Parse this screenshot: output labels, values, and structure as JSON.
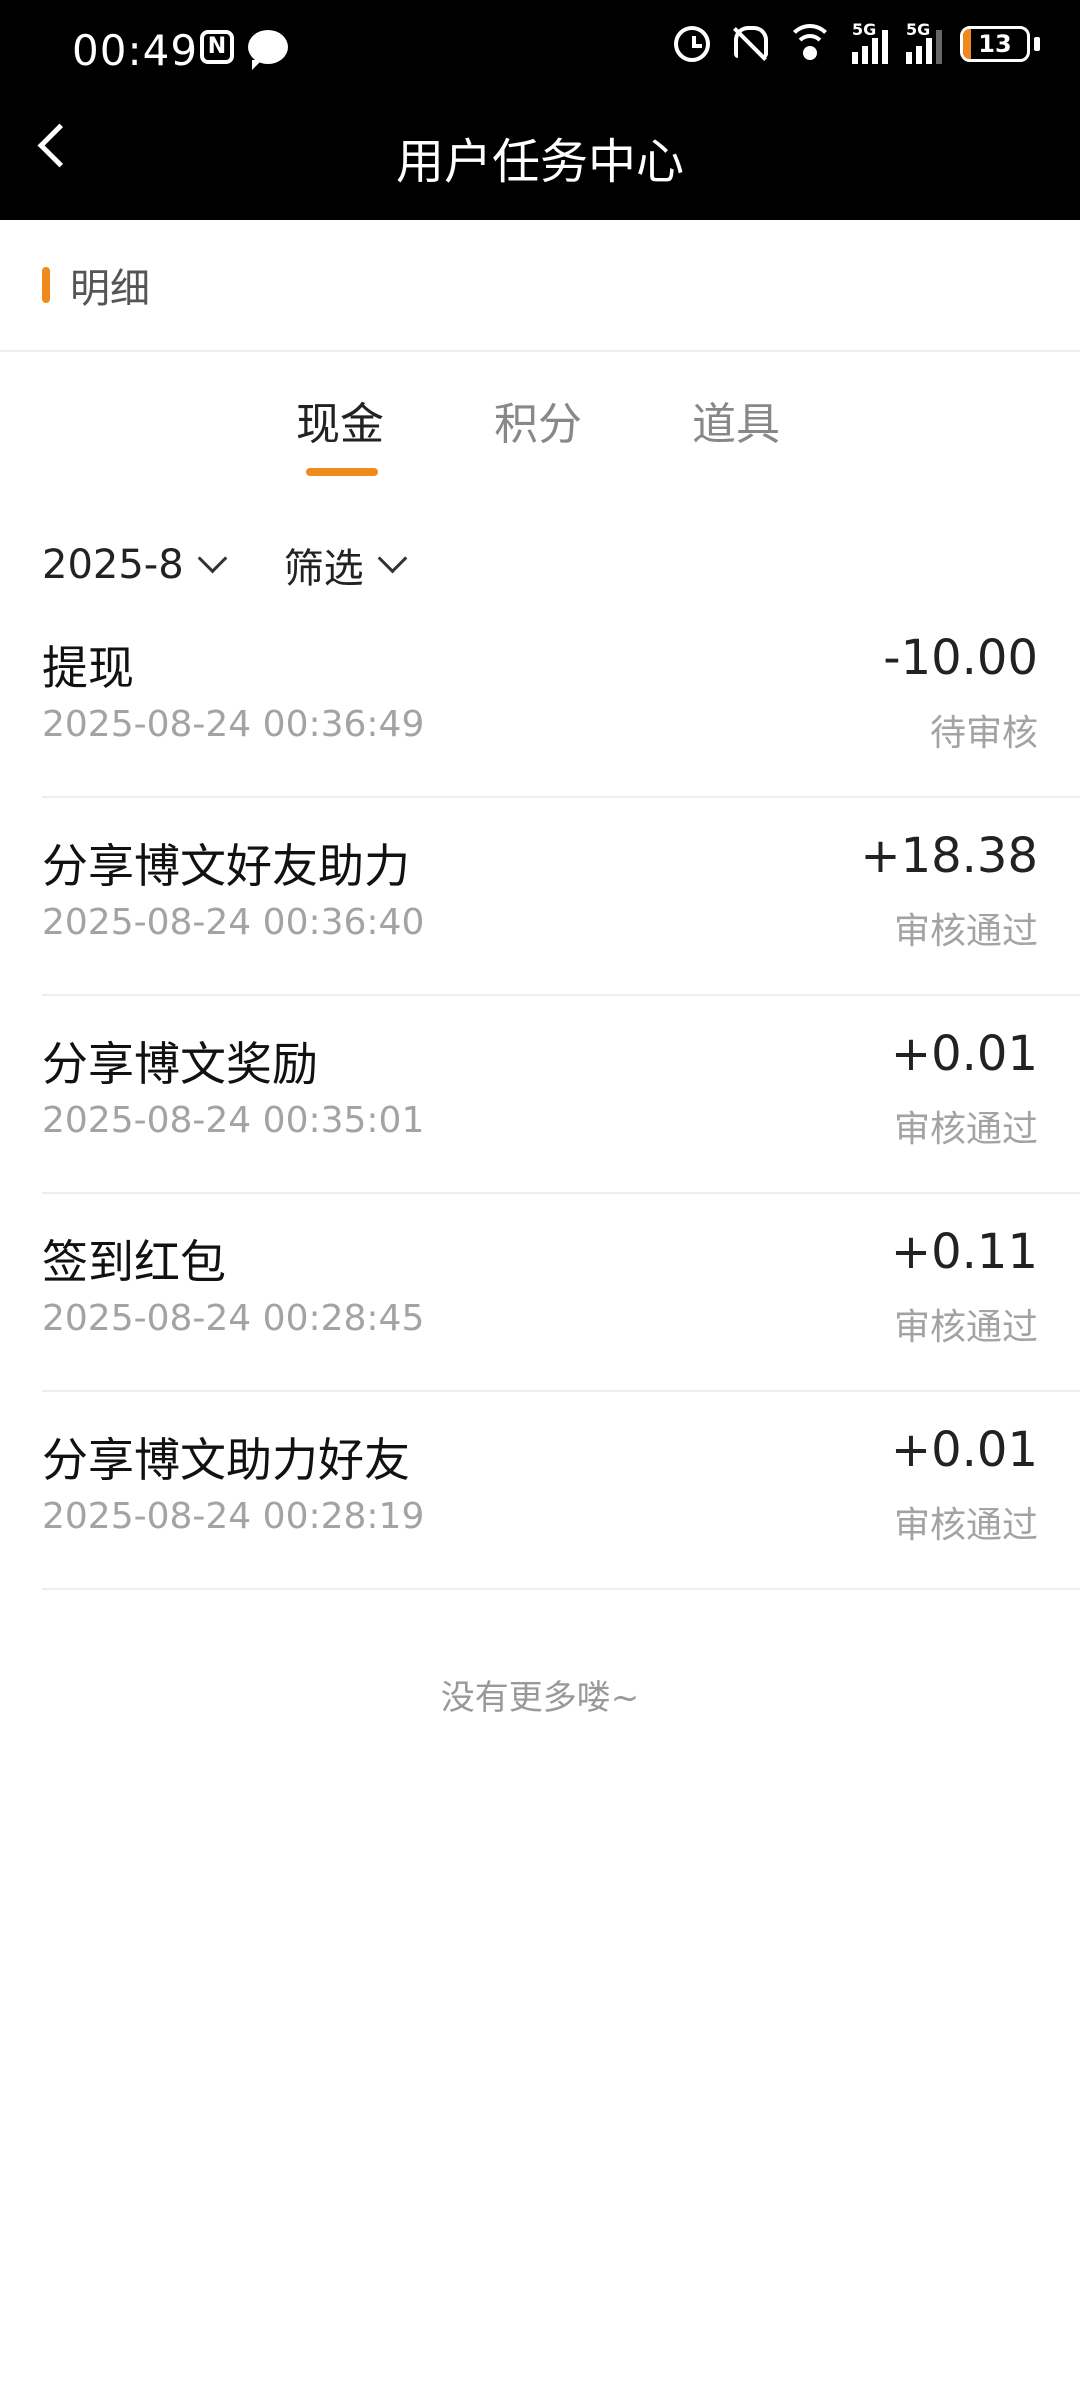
{
  "status_bar": {
    "time": "00:49",
    "battery": "13",
    "signal_label_1": "5G",
    "signal_label_2": "5G",
    "nfc_letter": "N"
  },
  "nav": {
    "title": "用户任务中心"
  },
  "section": {
    "title": "明细"
  },
  "tabs": [
    {
      "label": "现金",
      "active": true
    },
    {
      "label": "积分",
      "active": false
    },
    {
      "label": "道具",
      "active": false
    }
  ],
  "filters": {
    "month": "2025-8",
    "filter_label": "筛选"
  },
  "transactions": [
    {
      "title": "提现",
      "time": "2025-08-24 00:36:49",
      "amount": "-10.00",
      "status": "待审核"
    },
    {
      "title": "分享博文好友助力",
      "time": "2025-08-24 00:36:40",
      "amount": "+18.38",
      "status": "审核通过"
    },
    {
      "title": "分享博文奖励",
      "time": "2025-08-24 00:35:01",
      "amount": "+0.01",
      "status": "审核通过"
    },
    {
      "title": "签到红包",
      "time": "2025-08-24 00:28:45",
      "amount": "+0.11",
      "status": "审核通过"
    },
    {
      "title": "分享博文助力好友",
      "time": "2025-08-24 00:28:19",
      "amount": "+0.01",
      "status": "审核通过"
    }
  ],
  "footer": {
    "no_more": "没有更多喽~"
  },
  "colors": {
    "accent": "#f08a1c",
    "header_bg": "#000000"
  }
}
